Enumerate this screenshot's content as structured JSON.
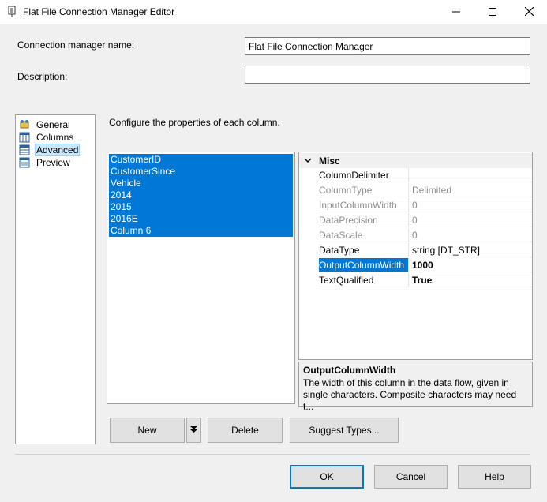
{
  "window": {
    "title": "Flat File Connection Manager Editor",
    "minimize_icon": "minimize-icon",
    "maximize_icon": "maximize-icon",
    "close_icon": "close-icon"
  },
  "form": {
    "name_label": "Connection manager name:",
    "name_value": "Flat File Connection Manager",
    "description_label": "Description:",
    "description_value": ""
  },
  "nav": {
    "items": [
      {
        "label": "General",
        "icon": "general-icon"
      },
      {
        "label": "Columns",
        "icon": "columns-icon"
      },
      {
        "label": "Advanced",
        "icon": "advanced-icon",
        "selected": true
      },
      {
        "label": "Preview",
        "icon": "preview-icon"
      }
    ]
  },
  "main": {
    "instruction": "Configure the properties of each column.",
    "columns": [
      "CustomerID",
      "CustomerSince",
      "Vehicle",
      "2014",
      "2015",
      "2016E",
      "Column 6"
    ]
  },
  "properties": {
    "category": "Misc",
    "rows": [
      {
        "name": "ColumnDelimiter",
        "value": ""
      },
      {
        "name": "ColumnType",
        "value": "Delimited"
      },
      {
        "name": "InputColumnWidth",
        "value": "0"
      },
      {
        "name": "DataPrecision",
        "value": "0"
      },
      {
        "name": "DataScale",
        "value": "0"
      },
      {
        "name": "DataType",
        "value": "string [DT_STR]"
      },
      {
        "name": "OutputColumnWidth",
        "value": "1000"
      },
      {
        "name": "TextQualified",
        "value": "True"
      }
    ]
  },
  "description_panel": {
    "title": "OutputColumnWidth",
    "text": "The width of this column in the data flow, given in single characters. Composite characters may need t..."
  },
  "buttons": {
    "new": "New",
    "delete": "Delete",
    "suggest": "Suggest Types...",
    "ok": "OK",
    "cancel": "Cancel",
    "help": "Help"
  },
  "colors": {
    "selection": "#0078d7",
    "window_bg": "#f0f0f0"
  }
}
